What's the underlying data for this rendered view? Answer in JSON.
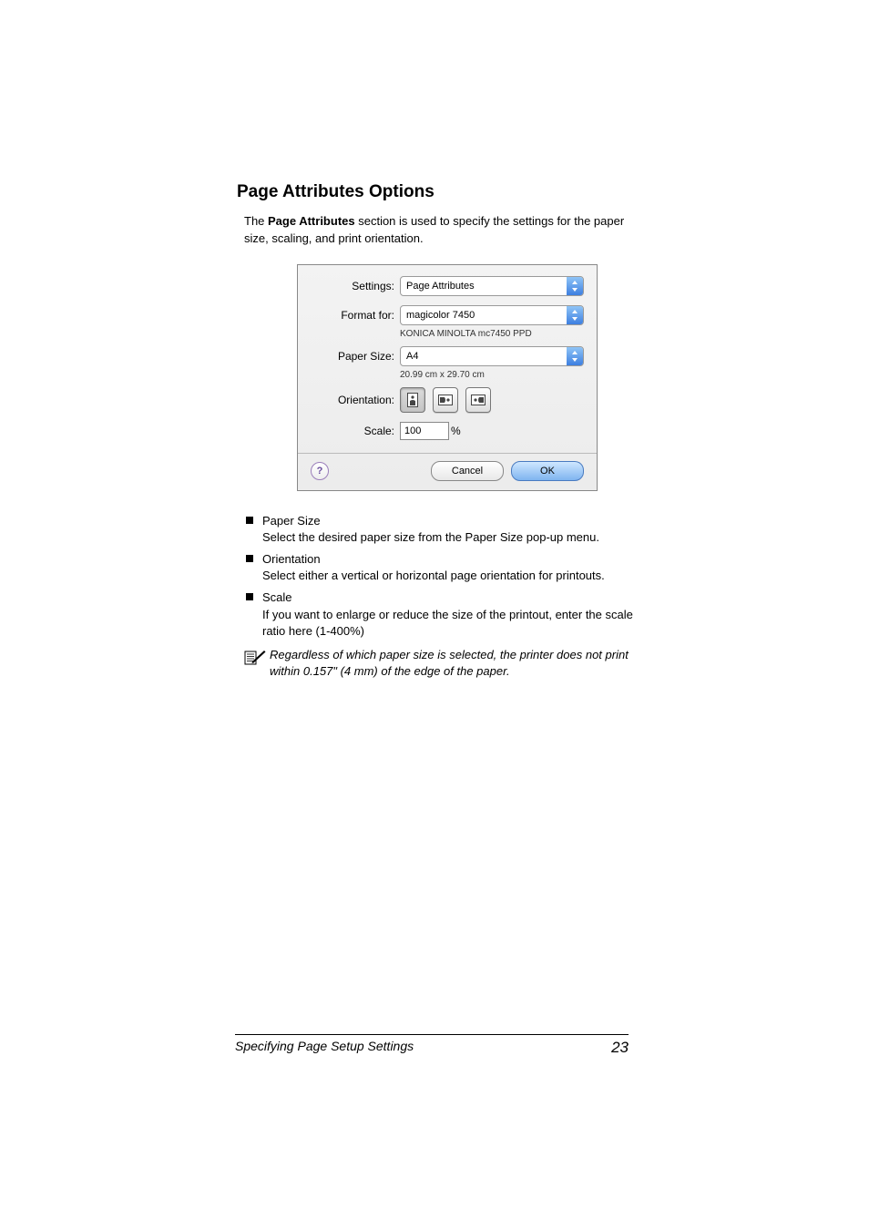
{
  "heading": "Page Attributes Options",
  "intro_before": "The ",
  "intro_strong": "Page Attributes",
  "intro_after": " section is used to specify the settings for the paper size, scaling, and print orientation.",
  "dialog": {
    "settings_label": "Settings:",
    "settings_value": "Page Attributes",
    "format_label": "Format for:",
    "format_value": "magicolor 7450",
    "format_sub": "KONICA MINOLTA mc7450 PPD",
    "paper_label": "Paper Size:",
    "paper_value": "A4",
    "paper_sub": "20.99 cm x 29.70 cm",
    "orient_label": "Orientation:",
    "scale_label": "Scale:",
    "scale_value": "100",
    "scale_pct": "%",
    "help": "?",
    "cancel": "Cancel",
    "ok": "OK"
  },
  "bullets": {
    "b1_title": "Paper Size",
    "b1_text": "Select the desired paper size from the Paper Size pop-up menu.",
    "b2_title": "Orientation",
    "b2_text": "Select either a vertical or horizontal page orientation for printouts.",
    "b3_title": "Scale",
    "b3_text": "If you want to enlarge or reduce the size of the printout, enter the scale ratio here (1-400%)"
  },
  "note": "Regardless of which paper size is selected, the printer does not print within 0.157\" (4 mm) of the edge of the paper.",
  "footer_left": "Specifying Page Setup Settings",
  "footer_right": "23"
}
